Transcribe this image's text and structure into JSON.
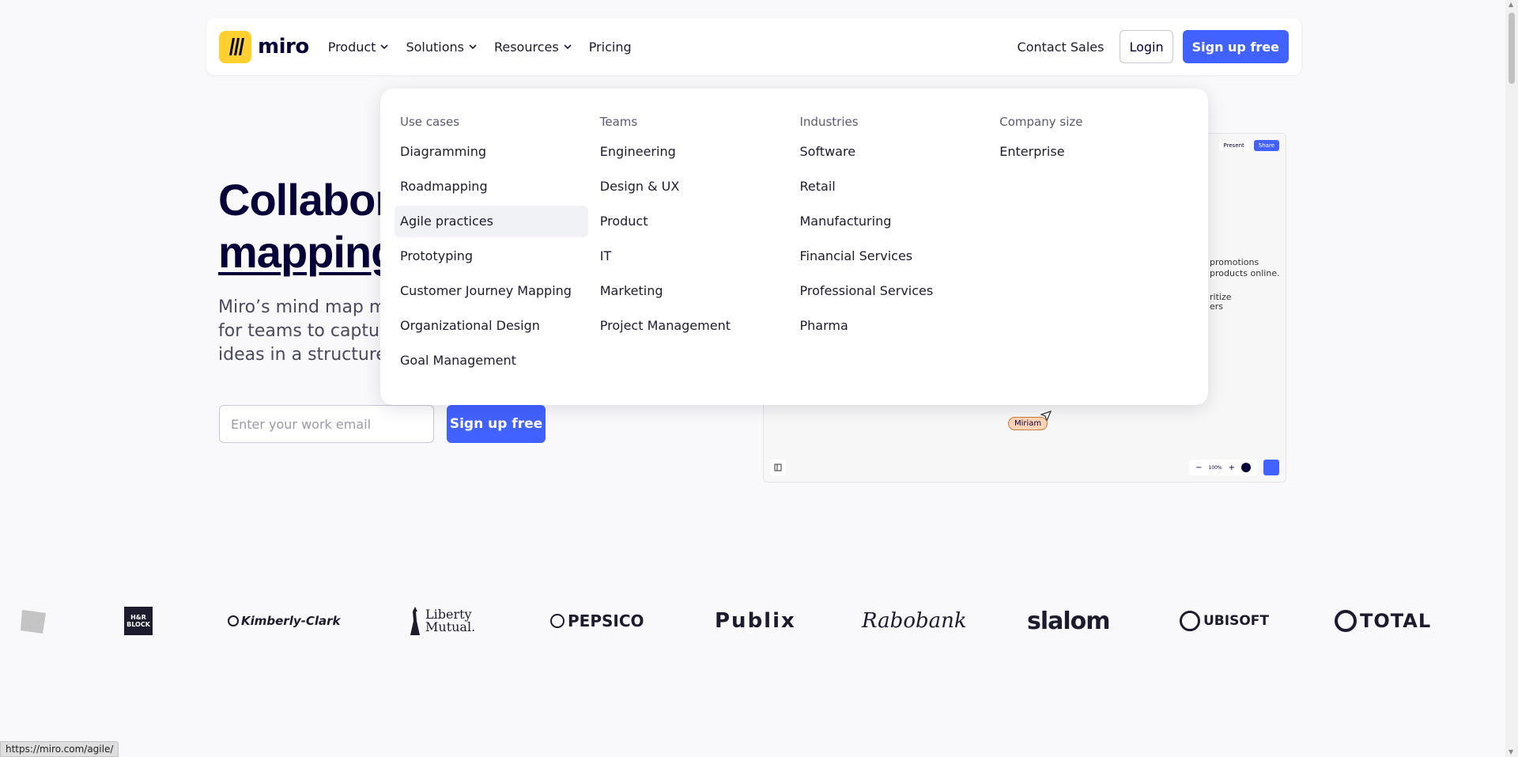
{
  "header": {
    "logo_text": "miro",
    "nav": [
      {
        "label": "Product",
        "has_dropdown": true
      },
      {
        "label": "Solutions",
        "has_dropdown": true
      },
      {
        "label": "Resources",
        "has_dropdown": true
      },
      {
        "label": "Pricing",
        "has_dropdown": false
      }
    ],
    "contact_sales": "Contact Sales",
    "login": "Login",
    "signup": "Sign up free"
  },
  "hero": {
    "title_line1": "Collabor",
    "title_line2": "mapping",
    "subtitle_line1": "Miro’s mind map ma",
    "subtitle_line2": "for teams to capture",
    "subtitle_line3": "ideas in a structured",
    "email_placeholder": "Enter your work email",
    "signup": "Sign up free"
  },
  "board": {
    "present": "Present",
    "share": "Share",
    "text_line1": "promotions",
    "text_line2": "products online.",
    "text_line3": "ritize",
    "text_line4": "ers",
    "cursor_name": "Miriam",
    "zoom": "100%"
  },
  "dropdown": {
    "columns": [
      {
        "heading": "Use cases",
        "items": [
          "Diagramming",
          "Roadmapping",
          "Agile practices",
          "Prototyping",
          "Customer Journey Mapping",
          "Organizational Design",
          "Goal Management"
        ]
      },
      {
        "heading": "Teams",
        "items": [
          "Engineering",
          "Design & UX",
          "Product",
          "IT",
          "Marketing",
          "Project Management"
        ]
      },
      {
        "heading": "Industries",
        "items": [
          "Software",
          "Retail",
          "Manufacturing",
          "Financial Services",
          "Professional Services",
          "Pharma"
        ]
      },
      {
        "heading": "Company size",
        "items": [
          "Enterprise"
        ]
      }
    ],
    "active_item": "Agile practices"
  },
  "logos": [
    "H&R BLOCK",
    "Kimberly-Clark",
    "Liberty Mutual.",
    "PEPSICO",
    "Publix",
    "Rabobank",
    "slalom",
    "UBISOFT",
    "TOTAL"
  ],
  "status_url": "https://miro.com/agile/",
  "colors": {
    "accent": "#4262ff",
    "logo_yellow": "#ffd02f",
    "text": "#050038"
  }
}
